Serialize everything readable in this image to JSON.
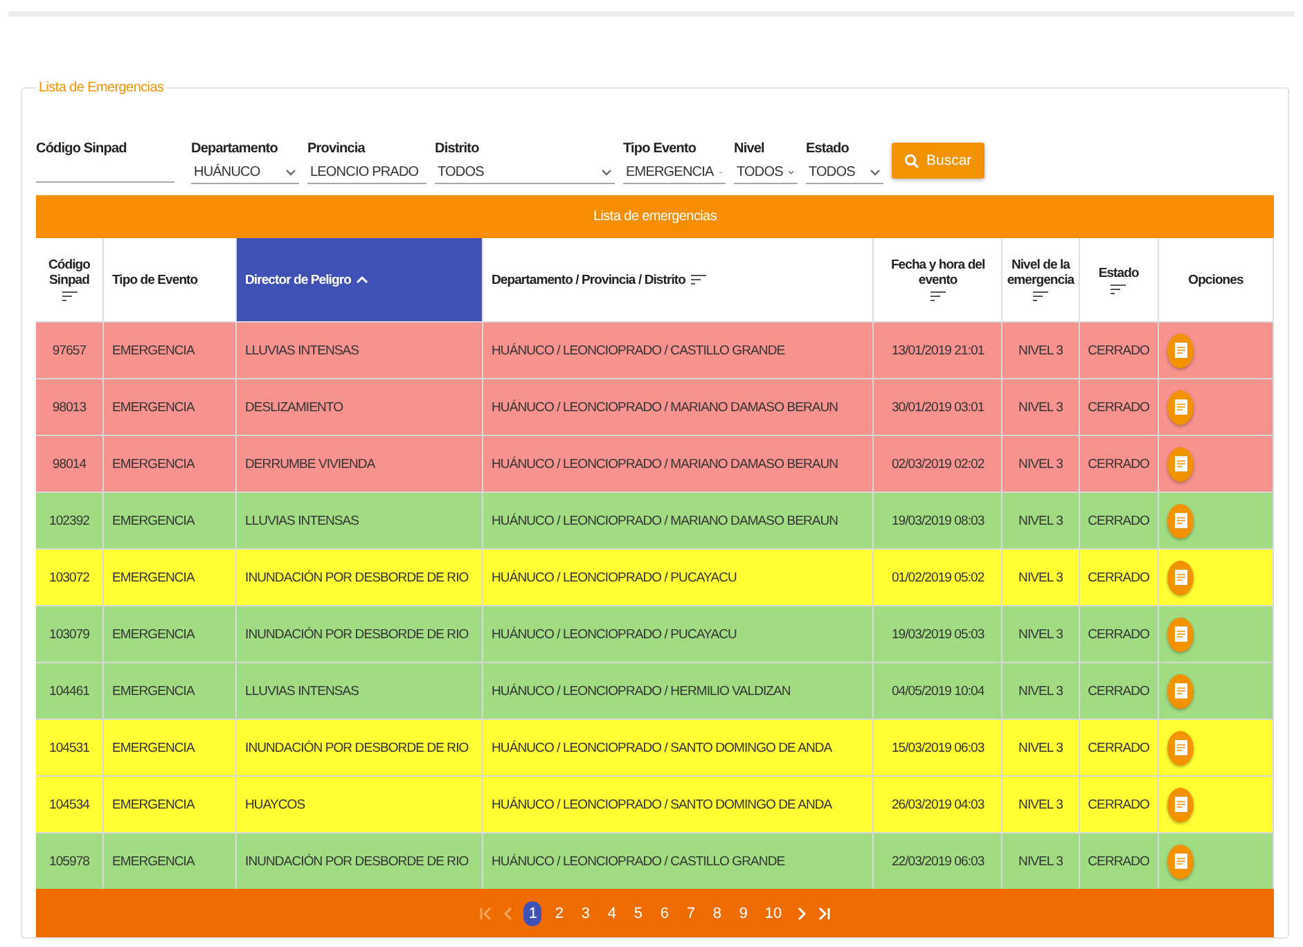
{
  "panel": {
    "legend": "Lista de Emergencias"
  },
  "filters": [
    {
      "kind": "input",
      "label": "Código Sinpad"
    },
    {
      "kind": "select",
      "label": "Departamento",
      "value": "HUÁNUCO"
    },
    {
      "kind": "select",
      "label": "Provincia",
      "value": "LEONCIO PRADO"
    },
    {
      "kind": "select",
      "label": "Distrito",
      "value": "TODOS"
    },
    {
      "kind": "select",
      "label": "Tipo Evento",
      "value": "EMERGENCIA"
    },
    {
      "kind": "select",
      "label": "Nivel",
      "value": "TODOS"
    },
    {
      "kind": "select",
      "label": "Estado",
      "value": "TODOS"
    }
  ],
  "search_button": {
    "label": "Buscar"
  },
  "table": {
    "title": "Lista de emergencias",
    "columns": [
      {
        "label": "Código Sinpad",
        "sortable": true,
        "selected": false
      },
      {
        "label": "Tipo de Evento",
        "sortable": false,
        "selected": false
      },
      {
        "label": "Director de Peligro",
        "sortable": true,
        "selected": true
      },
      {
        "label": "Departamento / Provincia / Distrito",
        "sortable": true,
        "selected": false
      },
      {
        "label": "Fecha y hora del evento",
        "sortable": true,
        "selected": false
      },
      {
        "label": "Nivel de la emergencia",
        "sortable": true,
        "selected": false
      },
      {
        "label": "Estado",
        "sortable": true,
        "selected": false
      },
      {
        "label": "Opciones",
        "sortable": false,
        "selected": false
      }
    ],
    "rows": [
      {
        "color": "#f7928e",
        "cells": [
          "97657",
          "EMERGENCIA",
          "LLUVIAS INTENSAS",
          "HUÁNUCO / LEONCIOPRADO / CASTILLO GRANDE",
          "13/01/2019 21:01",
          "NIVEL 3",
          "CERRADO"
        ]
      },
      {
        "color": "#f7928e",
        "cells": [
          "98013",
          "EMERGENCIA",
          "DESLIZAMIENTO",
          "HUÁNUCO / LEONCIOPRADO / MARIANO DAMASO BERAUN",
          "30/01/2019 03:01",
          "NIVEL 3",
          "CERRADO"
        ]
      },
      {
        "color": "#f7928e",
        "cells": [
          "98014",
          "EMERGENCIA",
          "DERRUMBE VIVIENDA",
          "HUÁNUCO / LEONCIOPRADO / MARIANO DAMASO BERAUN",
          "02/03/2019 02:02",
          "NIVEL 3",
          "CERRADO"
        ]
      },
      {
        "color": "#a1dc83",
        "cells": [
          "102392",
          "EMERGENCIA",
          "LLUVIAS INTENSAS",
          "HUÁNUCO / LEONCIOPRADO / MARIANO DAMASO BERAUN",
          "19/03/2019 08:03",
          "NIVEL 3",
          "CERRADO"
        ]
      },
      {
        "color": "#ffff33",
        "cells": [
          "103072",
          "EMERGENCIA",
          "INUNDACIÓN POR DESBORDE DE RIO",
          "HUÁNUCO / LEONCIOPRADO / PUCAYACU",
          "01/02/2019 05:02",
          "NIVEL 3",
          "CERRADO"
        ]
      },
      {
        "color": "#a1dc83",
        "cells": [
          "103079",
          "EMERGENCIA",
          "INUNDACIÓN POR DESBORDE DE RIO",
          "HUÁNUCO / LEONCIOPRADO / PUCAYACU",
          "19/03/2019 05:03",
          "NIVEL 3",
          "CERRADO"
        ]
      },
      {
        "color": "#a1dc83",
        "cells": [
          "104461",
          "EMERGENCIA",
          "LLUVIAS INTENSAS",
          "HUÁNUCO / LEONCIOPRADO / HERMILIO VALDIZAN",
          "04/05/2019 10:04",
          "NIVEL 3",
          "CERRADO"
        ]
      },
      {
        "color": "#ffff33",
        "cells": [
          "104531",
          "EMERGENCIA",
          "INUNDACIÓN POR DESBORDE DE RIO",
          "HUÁNUCO / LEONCIOPRADO / SANTO DOMINGO DE ANDA",
          "15/03/2019 06:03",
          "NIVEL 3",
          "CERRADO"
        ]
      },
      {
        "color": "#ffff33",
        "cells": [
          "104534",
          "EMERGENCIA",
          "HUAYCOS",
          "HUÁNUCO / LEONCIOPRADO / SANTO DOMINGO DE ANDA",
          "26/03/2019 04:03",
          "NIVEL 3",
          "CERRADO"
        ]
      },
      {
        "color": "#a1dc83",
        "cells": [
          "105978",
          "EMERGENCIA",
          "INUNDACIÓN POR DESBORDE DE RIO",
          "HUÁNUCO / LEONCIOPRADO / CASTILLO GRANDE",
          "22/03/2019 06:03",
          "NIVEL 3",
          "CERRADO"
        ]
      }
    ]
  },
  "pagination": {
    "first_disabled": true,
    "prev_disabled": true,
    "next_disabled": false,
    "last_disabled": false,
    "pages": [
      {
        "label": "1",
        "selected": true
      },
      {
        "label": "2",
        "selected": false
      },
      {
        "label": "3",
        "selected": false
      },
      {
        "label": "4",
        "selected": false
      },
      {
        "label": "5",
        "selected": false
      },
      {
        "label": "6",
        "selected": false
      },
      {
        "label": "7",
        "selected": false
      },
      {
        "label": "8",
        "selected": false
      },
      {
        "label": "9",
        "selected": false
      },
      {
        "label": "10",
        "selected": false
      }
    ]
  }
}
